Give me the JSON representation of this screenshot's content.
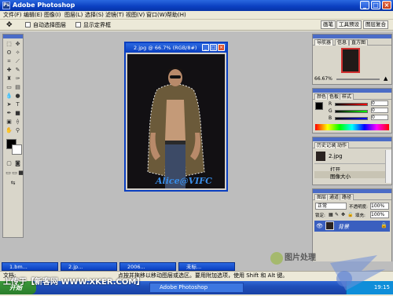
{
  "app": {
    "title": "Adobe Photoshop",
    "window_buttons": [
      "_",
      "□",
      "×"
    ]
  },
  "menu": [
    "文件(F)",
    "编辑(E)",
    "图像(I)",
    "图层(L)",
    "选择(S)",
    "滤镜(T)",
    "视图(V)",
    "窗口(W)",
    "帮助(H)"
  ],
  "options_bar": {
    "checkbox1_label": "自动选择图层",
    "checkbox2_label": "显示定界框",
    "right_tabs": [
      "画笔",
      "工具预设",
      "图层复合"
    ]
  },
  "document": {
    "title": "2.jpg @ 66.7% (RGB/8#)",
    "watermark": "Alice@VIFC"
  },
  "panels": {
    "navigator": {
      "tabs": [
        "导航器",
        "信息",
        "直方图"
      ],
      "zoom": "66.67%"
    },
    "color": {
      "tabs": [
        "颜色",
        "色板",
        "样式"
      ],
      "channels": [
        "R",
        "G",
        "B"
      ],
      "values": [
        "0",
        "0",
        "0"
      ]
    },
    "history": {
      "tabs": [
        "历史记录",
        "动作"
      ],
      "snapshot": "2.jpg",
      "items": [
        "打开",
        "图像大小"
      ]
    },
    "layers": {
      "tabs": [
        "图层",
        "通道",
        "路径"
      ],
      "blend_mode": "正常",
      "opacity_label": "不透明度:",
      "opacity_value": "100%",
      "lock_label": "锁定:",
      "fill_label": "填充:",
      "fill_value": "100%",
      "layer_name": "背景"
    }
  },
  "minimized_docs": [
    "1.bm...",
    "2.jp...",
    "2006...",
    "未标..."
  ],
  "status": {
    "doc": "文档:",
    "hint": "点按并拖移以移动图层或选区。要用附加选项，使用 Shift 和 Alt 键。"
  },
  "taskbar": {
    "start": "开始",
    "item": "Adobe Photoshop",
    "clock": "19:15"
  },
  "overlays": {
    "site_watermark": "上传于【新客网 WWW.XKER.COM】",
    "brand_watermark": "图片处理"
  }
}
